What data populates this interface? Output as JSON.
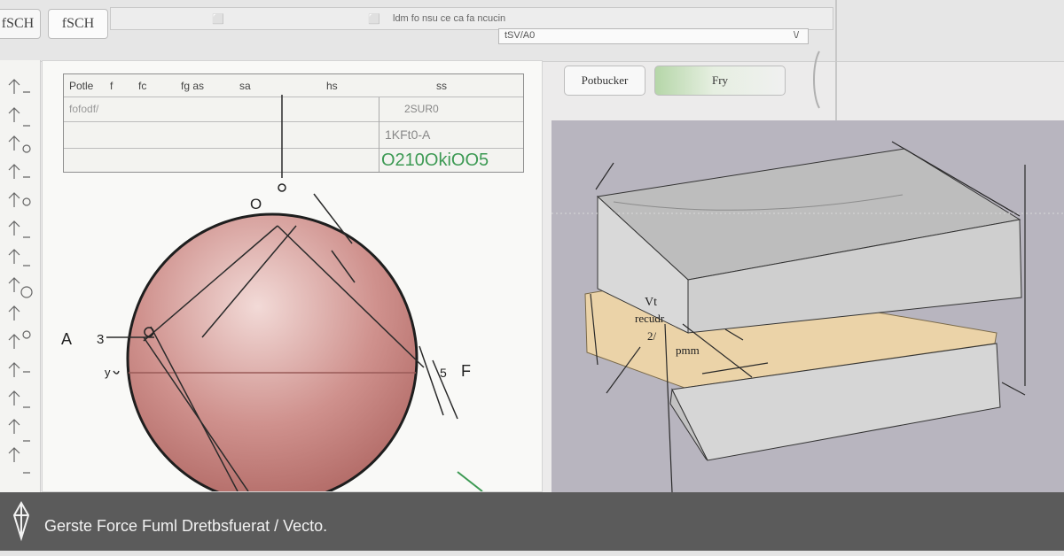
{
  "toolbar": {
    "left_button_label": "fSCH",
    "tab_label": "fSCH",
    "menu_text": "ldm fo nsu ce ca fa ncucin",
    "field_text": "tSV/A0",
    "field_chevron": "\\/"
  },
  "table": {
    "header": [
      "Potle",
      "f",
      "fc",
      "fg as",
      "sa",
      "hs",
      "ss"
    ],
    "row1_left": "fofodf/",
    "row1_right": "2SUR0",
    "row2_right": "1KFt0-A",
    "row3_right": "O210OkiOO5"
  },
  "canvas_left": {
    "labels": {
      "point_o_top": "O",
      "point_o_upper": "O",
      "point_a": "A",
      "point_a_mark": "3",
      "point_o_left": "O",
      "point_f": "F",
      "point_f_mark": "5",
      "point_small": "y"
    },
    "sphere_color": "#c98a86"
  },
  "right_controls": {
    "button_label": "Potbucker",
    "primary_label": "Fry"
  },
  "canvas_right": {
    "annotation_1": "Vt",
    "annotation_2": "recudr",
    "annotation_3": "2/",
    "annotation_4": "pmm",
    "box_color": "#d4d4d4",
    "plate_color": "#ebd3a8"
  },
  "footer": {
    "title": "Gerste Force Fuml Dretbsfuerat / Vecto."
  },
  "colors": {
    "footer_bg": "#5b5b5b",
    "accent_green": "#3d9a54"
  }
}
